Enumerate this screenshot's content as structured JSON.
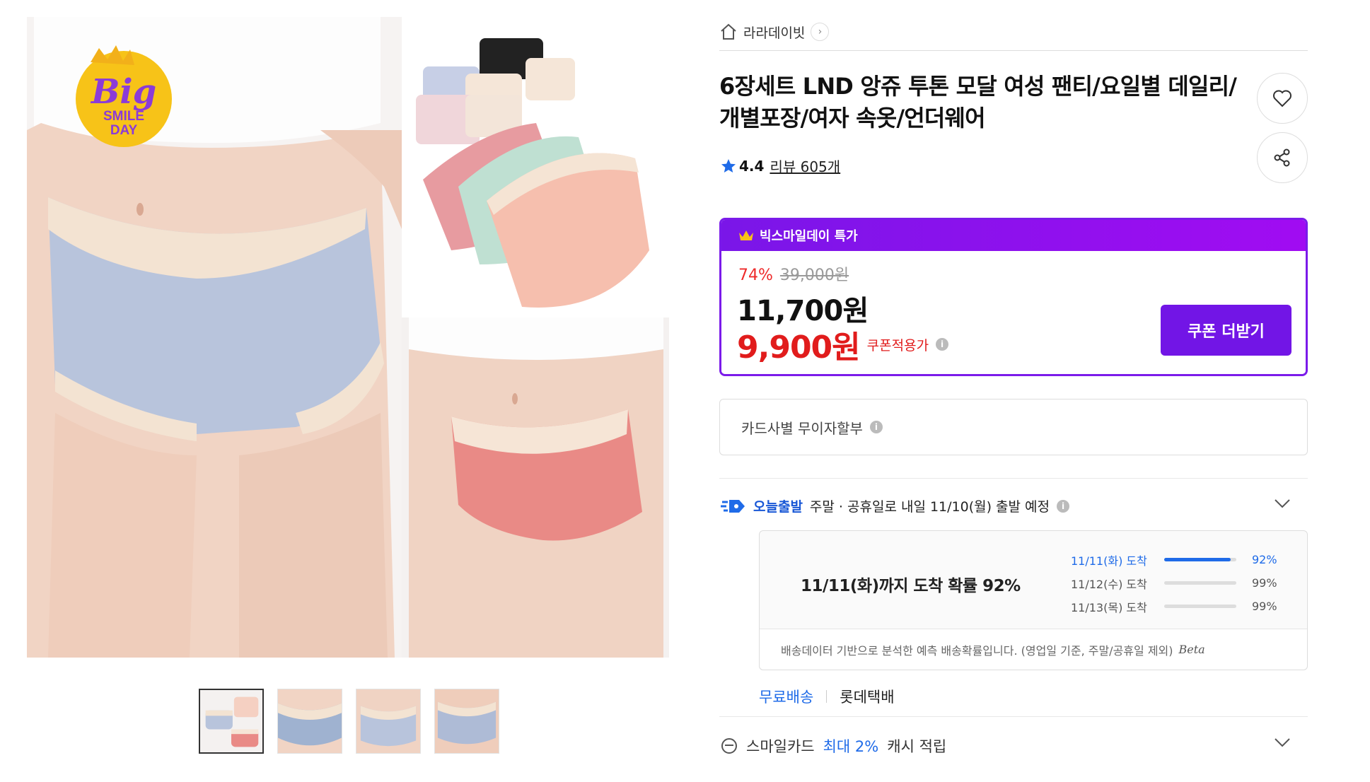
{
  "gallery": {
    "badge": {
      "line1": "Big",
      "line2": "SMILE",
      "line3": "DAY"
    },
    "thumbnail_count": 4
  },
  "seller": {
    "name": "라라데이빗",
    "icon": "home-icon"
  },
  "product": {
    "title": "6장세트 LND 앙쥬 투톤 모달 여성 팬티/요일별 데일리/개별포장/여자 속옷/언더웨어",
    "rating": "4.4",
    "review_label": "리뷰 605개"
  },
  "price_box": {
    "event_label": "빅스마일데이 특가",
    "discount_rate": "74%",
    "original_price": "39,000원",
    "sale_price": "11,700원",
    "coupon_price": "9,900원",
    "coupon_price_label": "쿠폰적용가",
    "coupon_button": "쿠폰 더받기",
    "accent_color": "#7b1bea",
    "price_color": "#e11c1c"
  },
  "installment": {
    "label": "카드사별 무이자할부"
  },
  "shipping": {
    "tag": "오늘출발",
    "text": "주말 · 공휴일로 내일 11/10(월) 출발 예정",
    "probability_headline": "11/11(화)까지 도착 확률 92%",
    "probabilities": [
      {
        "date": "11/11(화) 도착",
        "percent": "92%",
        "value": 0.92
      },
      {
        "date": "11/12(수) 도착",
        "percent": "99%",
        "value": 0.99
      },
      {
        "date": "11/13(목) 도착",
        "percent": "99%",
        "value": 0.99
      }
    ],
    "footnote": "배송데이터 기반으로 분석한 예측 배송확률입니다. (영업일 기준, 주말/공휴일 제외)",
    "beta": "Beta",
    "free_label": "무료배송",
    "carrier": "롯데택배"
  },
  "smilecard": {
    "prefix": "스마일카드",
    "highlight": "최대 2%",
    "suffix": "캐시 적립"
  }
}
